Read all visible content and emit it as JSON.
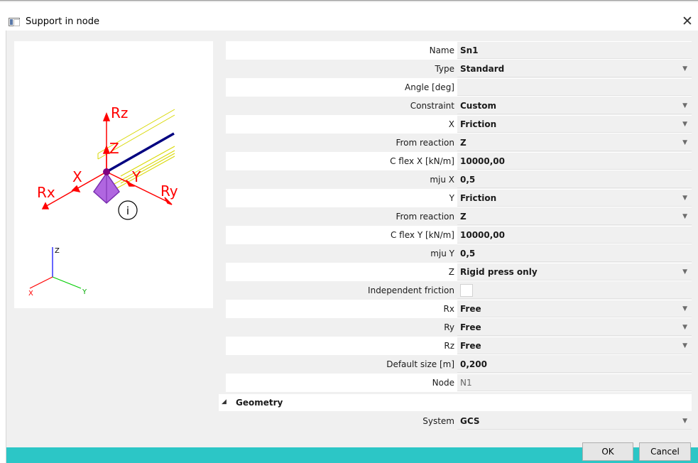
{
  "window": {
    "title": "Support in node",
    "close_glyph": "✕"
  },
  "preview": {
    "labels": {
      "rz": "Rz",
      "z": "Z",
      "x": "X",
      "y": "Y",
      "rx": "Rx",
      "ry": "Ry",
      "info": "i"
    },
    "axes": {
      "z": "Z",
      "x": "X",
      "y": "Y"
    },
    "colors": {
      "arrows": "#ff0000",
      "beam": "#000080",
      "support": "#9933cc",
      "guides": "#d8d800"
    }
  },
  "properties": [
    {
      "label": "Name",
      "value": "Sn1",
      "dropdown": false
    },
    {
      "label": "Type",
      "value": "Standard",
      "dropdown": true
    },
    {
      "label": "Angle [deg]",
      "value": "",
      "dropdown": false
    },
    {
      "label": "Constraint",
      "value": "Custom",
      "dropdown": true
    },
    {
      "label": "X",
      "value": "Friction",
      "dropdown": true
    },
    {
      "label": "From reaction",
      "value": "Z",
      "dropdown": true
    },
    {
      "label": "C flex X [kN/m]",
      "value": "10000,00",
      "dropdown": false
    },
    {
      "label": "mju X",
      "value": "0,5",
      "dropdown": false
    },
    {
      "label": "Y",
      "value": "Friction",
      "dropdown": true
    },
    {
      "label": "From reaction",
      "value": "Z",
      "dropdown": true
    },
    {
      "label": "C flex Y [kN/m]",
      "value": "10000,00",
      "dropdown": false
    },
    {
      "label": "mju Y",
      "value": "0,5",
      "dropdown": false
    },
    {
      "label": "Z",
      "value": "Rigid press only",
      "dropdown": true
    },
    {
      "label": "Independent friction",
      "value": "",
      "checkbox": true
    },
    {
      "label": "Rx",
      "value": "Free",
      "dropdown": true
    },
    {
      "label": "Ry",
      "value": "Free",
      "dropdown": true
    },
    {
      "label": "Rz",
      "value": "Free",
      "dropdown": true
    },
    {
      "label": "Default size [m]",
      "value": "0,200",
      "dropdown": false
    },
    {
      "label": "Node",
      "value": "N1",
      "dropdown": false,
      "readonly": true
    }
  ],
  "geometry": {
    "section_title": "Geometry",
    "system_label": "System",
    "system_value": "GCS"
  },
  "buttons": {
    "ok": "OK",
    "cancel": "Cancel"
  },
  "icons": {
    "dropdown": "chevron-down-icon",
    "collapse": "triangle-collapse-icon",
    "app": "window-app-icon"
  },
  "colors": {
    "statusbar": "#2cc6c6",
    "panel": "#f0f0f0"
  }
}
